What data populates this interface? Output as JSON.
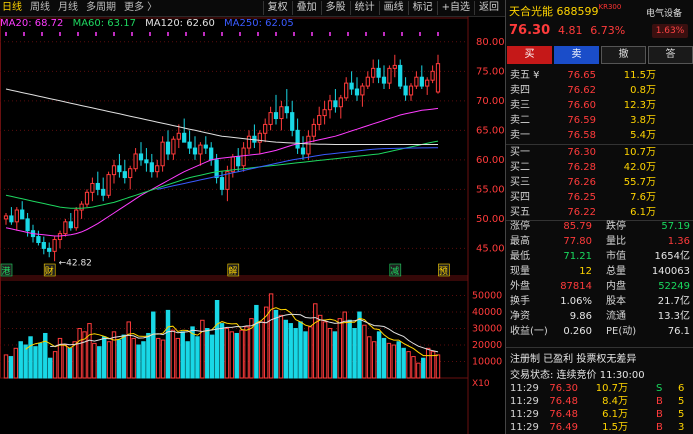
{
  "toolbar": {
    "tabs": [
      "日线",
      "周线",
      "月线",
      "多周期",
      "更多 〉"
    ],
    "active_tab": 0,
    "tools": [
      "复权",
      "叠加",
      "多股",
      "统计",
      "画线",
      "标记",
      "+自选",
      "返回"
    ]
  },
  "ma": [
    {
      "label": "MA20: 68.72",
      "color": "#ff3cff"
    },
    {
      "label": "MA60: 63.17",
      "color": "#1ed760"
    },
    {
      "label": "MA120: 62.60",
      "color": "#e0e0e0"
    },
    {
      "label": "MA250: 62.05",
      "color": "#3a5bff"
    }
  ],
  "colors": {
    "up": "#ff3b3b",
    "down": "#19d8e6",
    "grid": "#3a0a0a"
  },
  "chart_data": {
    "type": "candlestick",
    "price_axis": {
      "ticks": [
        45,
        50,
        55,
        60,
        65,
        70,
        75,
        80
      ],
      "ylim": [
        41,
        82
      ]
    },
    "price_tick_labels": [
      "45.00",
      "50.00",
      "55.00",
      "60.00",
      "65.00",
      "70.00",
      "75.00",
      "80.00"
    ],
    "volume_axis": {
      "ticks": [
        10000,
        20000,
        30000,
        40000,
        50000
      ],
      "ylim": [
        0,
        57000
      ]
    },
    "volume_tick_labels": [
      "10000",
      "20000",
      "30000",
      "40000",
      "50000"
    ],
    "volume_unit": "X10",
    "low_annotation": "←42.82",
    "low_price": 42.82,
    "event_markers": [
      {
        "index": 0,
        "label": "港",
        "color": "#1ed760"
      },
      {
        "index": 8,
        "label": "财",
        "color": "#ffd400"
      },
      {
        "index": 42,
        "label": "解",
        "color": "#ffd400"
      },
      {
        "index": 72,
        "label": "减",
        "color": "#1ed760"
      },
      {
        "index": 81,
        "label": "预",
        "color": "#ffd400"
      }
    ],
    "candles": [
      [
        50,
        51,
        49,
        50.5
      ],
      [
        50.5,
        52,
        49,
        49.5
      ],
      [
        49.5,
        52,
        48,
        51.5
      ],
      [
        51.5,
        53,
        50,
        50
      ],
      [
        50,
        51,
        47,
        48
      ],
      [
        48,
        49,
        46,
        47
      ],
      [
        47,
        48,
        45.5,
        46
      ],
      [
        46,
        47,
        44,
        45
      ],
      [
        45,
        46,
        43.5,
        44.5
      ],
      [
        44.5,
        47,
        42.82,
        46.5
      ],
      [
        46.5,
        48,
        45,
        47.5
      ],
      [
        47.5,
        50,
        47,
        49.5
      ],
      [
        49.5,
        51,
        48,
        48.5
      ],
      [
        48.5,
        52,
        48,
        51.5
      ],
      [
        51.5,
        53,
        50,
        52.5
      ],
      [
        52.5,
        55,
        52,
        54.5
      ],
      [
        54.5,
        57,
        53,
        56
      ],
      [
        56,
        58,
        54,
        55
      ],
      [
        55,
        57,
        53,
        54
      ],
      [
        54,
        58,
        53.5,
        57.5
      ],
      [
        57.5,
        60,
        56,
        59
      ],
      [
        59,
        61,
        57,
        58
      ],
      [
        58,
        60,
        56,
        57
      ],
      [
        57,
        59,
        55,
        58.5
      ],
      [
        58.5,
        62,
        58,
        61
      ],
      [
        61,
        63,
        59,
        60
      ],
      [
        60,
        62,
        58,
        59.5
      ],
      [
        59.5,
        61,
        57,
        58
      ],
      [
        58,
        60,
        57,
        59
      ],
      [
        59,
        64,
        58,
        63
      ],
      [
        63,
        65,
        60,
        61
      ],
      [
        61,
        64,
        60,
        63.5
      ],
      [
        63.5,
        66,
        62,
        64.5
      ],
      [
        64.5,
        67,
        63,
        63
      ],
      [
        63,
        65,
        61,
        62
      ],
      [
        62,
        64,
        60,
        61
      ],
      [
        61,
        63,
        59,
        62.5
      ],
      [
        62.5,
        64,
        61,
        62
      ],
      [
        62,
        63,
        59,
        60
      ],
      [
        60,
        61,
        56,
        57
      ],
      [
        57,
        58,
        54,
        55
      ],
      [
        55,
        59,
        53,
        58
      ],
      [
        58,
        61,
        57,
        60.5
      ],
      [
        60.5,
        62,
        58,
        59
      ],
      [
        59,
        63,
        58,
        62
      ],
      [
        62,
        65,
        61,
        64
      ],
      [
        64,
        66,
        62,
        63
      ],
      [
        63,
        65,
        61,
        64.5
      ],
      [
        64.5,
        67,
        63,
        66
      ],
      [
        66,
        69,
        65,
        68
      ],
      [
        68,
        71,
        66,
        67
      ],
      [
        67,
        70,
        65,
        69
      ],
      [
        69,
        72,
        67,
        68
      ],
      [
        68,
        70,
        64,
        65
      ],
      [
        65,
        67,
        61,
        62
      ],
      [
        62,
        64,
        60,
        61
      ],
      [
        61,
        65,
        60,
        64
      ],
      [
        64,
        67,
        63,
        66
      ],
      [
        66,
        69,
        65,
        67.5
      ],
      [
        67.5,
        70,
        66,
        68.5
      ],
      [
        68.5,
        71,
        67,
        70
      ],
      [
        70,
        72,
        68,
        69
      ],
      [
        69,
        71,
        67,
        70.5
      ],
      [
        70.5,
        74,
        70,
        73
      ],
      [
        73,
        75,
        71,
        72
      ],
      [
        72,
        74,
        70,
        71
      ],
      [
        71,
        73,
        69,
        72.5
      ],
      [
        72.5,
        75,
        72,
        74
      ],
      [
        74,
        77,
        73,
        75.5
      ],
      [
        75.5,
        77,
        73,
        74
      ],
      [
        74,
        76,
        72,
        73
      ],
      [
        73,
        76,
        72,
        75.5
      ],
      [
        75.5,
        77.8,
        74,
        76
      ],
      [
        76,
        77,
        72,
        72.5
      ],
      [
        72.5,
        74,
        70,
        71
      ],
      [
        71,
        73,
        70,
        72.5
      ],
      [
        72.5,
        75,
        72,
        74
      ],
      [
        74,
        76,
        72,
        72.5
      ],
      [
        72.5,
        74,
        71,
        73.5
      ],
      [
        73.5,
        76,
        73,
        75
      ],
      [
        71.5,
        77.8,
        71.21,
        76.3
      ]
    ],
    "ma_series": [
      {
        "name": "MA20",
        "color": "#ff3cff",
        "values": [
          48.5,
          48.3,
          48.1,
          47.9,
          47.7,
          47.5,
          47.4,
          47.3,
          47.2,
          47.1,
          47.1,
          47.2,
          47.3,
          47.5,
          47.8,
          48.2,
          48.7,
          49.2,
          49.8,
          50.4,
          51,
          51.6,
          52.2,
          52.8,
          53.4,
          54,
          54.5,
          55,
          55.5,
          56,
          56.5,
          57,
          57.5,
          58,
          58.4,
          58.8,
          59.2,
          59.6,
          60,
          60.2,
          60.3,
          60.4,
          60.5,
          60.6,
          60.7,
          60.8,
          60.9,
          61,
          61.2,
          61.4,
          61.6,
          61.9,
          62.2,
          62.5,
          62.7,
          62.8,
          63,
          63.2,
          63.4,
          63.6,
          63.8,
          64,
          64.3,
          64.6,
          64.9,
          65.2,
          65.5,
          65.8,
          66.1,
          66.4,
          66.7,
          67,
          67.3,
          67.6,
          67.8,
          68,
          68.2,
          68.4,
          68.5,
          68.6,
          68.72
        ]
      },
      {
        "name": "MA60",
        "color": "#1ed760",
        "values": [
          54,
          53.8,
          53.6,
          53.4,
          53.2,
          53,
          52.8,
          52.6,
          52.4,
          52.2,
          52,
          51.9,
          51.8,
          51.8,
          51.8,
          51.9,
          52,
          52.2,
          52.4,
          52.6,
          52.8,
          53.1,
          53.4,
          53.7,
          54,
          54.3,
          54.6,
          54.9,
          55.2,
          55.5,
          55.8,
          56.1,
          56.4,
          56.7,
          57,
          57.2,
          57.4,
          57.6,
          57.8,
          58,
          58.1,
          58.2,
          58.3,
          58.4,
          58.5,
          58.6,
          58.7,
          58.8,
          58.9,
          59,
          59.1,
          59.2,
          59.3,
          59.4,
          59.5,
          59.6,
          59.7,
          59.8,
          59.9,
          60,
          60.1,
          60.2,
          60.3,
          60.4,
          60.5,
          60.6,
          60.7,
          60.8,
          60.9,
          61,
          61.2,
          61.4,
          61.6,
          61.8,
          62,
          62.2,
          62.4,
          62.6,
          62.8,
          63,
          63.17
        ]
      },
      {
        "name": "MA120",
        "color": "#e0e0e0",
        "values": [
          72,
          71.8,
          71.6,
          71.4,
          71.2,
          71,
          70.8,
          70.6,
          70.4,
          70.2,
          70,
          69.8,
          69.6,
          69.4,
          69.2,
          69,
          68.8,
          68.6,
          68.4,
          68.2,
          68,
          67.8,
          67.6,
          67.4,
          67.2,
          67,
          66.8,
          66.6,
          66.4,
          66.2,
          66,
          65.8,
          65.6,
          65.4,
          65.2,
          65,
          64.8,
          64.6,
          64.4,
          64.2,
          64,
          63.9,
          63.8,
          63.7,
          63.6,
          63.5,
          63.4,
          63.3,
          63.2,
          63.1,
          63,
          62.95,
          62.9,
          62.85,
          62.8,
          62.75,
          62.7,
          62.68,
          62.66,
          62.64,
          62.62,
          62.6,
          62.6,
          62.6,
          62.6,
          62.6,
          62.6,
          62.6,
          62.6,
          62.6,
          62.6,
          62.6,
          62.6,
          62.6,
          62.6,
          62.6,
          62.6,
          62.6,
          62.6,
          62.6,
          62.6
        ]
      },
      {
        "name": "MA250",
        "color": "#3a5bff",
        "values": [
          null,
          null,
          null,
          null,
          null,
          null,
          null,
          null,
          null,
          null,
          null,
          null,
          null,
          null,
          null,
          null,
          null,
          null,
          null,
          null,
          null,
          null,
          null,
          null,
          null,
          null,
          null,
          null,
          55,
          55.2,
          55.4,
          55.6,
          55.8,
          56,
          56.2,
          56.4,
          56.6,
          56.8,
          57,
          57.2,
          57.4,
          57.6,
          57.8,
          58,
          58.2,
          58.4,
          58.6,
          58.8,
          59,
          59.2,
          59.4,
          59.6,
          59.8,
          60,
          60.15,
          60.3,
          60.45,
          60.6,
          60.75,
          60.9,
          61,
          61.1,
          61.2,
          61.3,
          61.4,
          61.5,
          61.6,
          61.7,
          61.8,
          61.85,
          61.9,
          61.92,
          61.94,
          61.96,
          61.98,
          62,
          62.01,
          62.02,
          62.03,
          62.04,
          62.05
        ]
      }
    ],
    "volumes": [
      14000,
      13000,
      18000,
      22000,
      20000,
      25000,
      19000,
      21000,
      27000,
      12000,
      16000,
      24000,
      20000,
      18000,
      22000,
      30000,
      28000,
      33000,
      21000,
      19000,
      25000,
      22000,
      28000,
      23000,
      26000,
      34000,
      24000,
      20000,
      22000,
      27000,
      40000,
      24000,
      23000,
      41000,
      29000,
      24000,
      28000,
      22000,
      31000,
      25000,
      35000,
      30000,
      26000,
      47000,
      33000,
      30000,
      28000,
      27000,
      29000,
      31000,
      36000,
      44000,
      34000,
      43000,
      51000,
      41000,
      38000,
      35000,
      33000,
      30000,
      34000,
      28000,
      31000,
      45000,
      38000,
      34000,
      30000,
      28000,
      36000,
      40000,
      35000,
      30000,
      40000,
      32000,
      25000,
      22000,
      28000,
      24000,
      21000,
      20000,
      22000,
      18000,
      16000,
      13000,
      9000,
      12000,
      18000,
      16000,
      14000
    ],
    "volume_ma": [
      {
        "name": "MA5",
        "color": "#ffd400"
      },
      {
        "name": "MA10",
        "color": "#e0e0e0"
      }
    ]
  },
  "quote": {
    "name": "天合光能",
    "code": "688599",
    "kr": "KR300",
    "sector": "电气设备",
    "sector_change": "1.63%",
    "price": "76.30",
    "change": "4.81",
    "change_pct": "6.73%"
  },
  "trade_buttons": [
    "买",
    "卖",
    "撤",
    "答"
  ],
  "asks": [
    {
      "label": "卖五 ¥",
      "price": "76.65",
      "vol": "11.5万"
    },
    {
      "label": "卖四",
      "price": "76.62",
      "vol": "0.8万"
    },
    {
      "label": "卖三",
      "price": "76.60",
      "vol": "12.3万"
    },
    {
      "label": "卖二",
      "price": "76.59",
      "vol": "3.8万"
    },
    {
      "label": "卖一",
      "price": "76.58",
      "vol": "5.4万"
    }
  ],
  "bids": [
    {
      "label": "买一",
      "price": "76.30",
      "vol": "10.7万"
    },
    {
      "label": "买二",
      "price": "76.28",
      "vol": "42.0万"
    },
    {
      "label": "买三",
      "price": "76.26",
      "vol": "55.7万"
    },
    {
      "label": "买四",
      "price": "76.25",
      "vol": "7.6万"
    },
    {
      "label": "买五",
      "price": "76.22",
      "vol": "6.1万"
    }
  ],
  "stats": [
    {
      "a": "涨停",
      "av": "85.79",
      "ac": "red",
      "b": "跌停",
      "bv": "57.19",
      "bc": "green"
    },
    {
      "a": "最高",
      "av": "77.80",
      "ac": "red",
      "b": "量比",
      "bv": "1.36",
      "bc": "red"
    },
    {
      "a": "最低",
      "av": "71.21",
      "ac": "green",
      "b": "市值",
      "bv": "1654亿",
      "bc": "white"
    },
    {
      "a": "现量",
      "av": "12",
      "ac": "yellow",
      "b": "总量",
      "bv": "140063",
      "bc": "white"
    },
    {
      "a": "外盘",
      "av": "87814",
      "ac": "red",
      "b": "内盘",
      "bv": "52249",
      "bc": "green"
    },
    {
      "a": "换手",
      "av": "1.06%",
      "ac": "white",
      "b": "股本",
      "bv": "21.7亿",
      "bc": "white"
    },
    {
      "a": "净资",
      "av": "9.86",
      "ac": "white",
      "b": "流通",
      "bv": "13.3亿",
      "bc": "white"
    },
    {
      "a": "收益(一)",
      "av": "0.260",
      "ac": "white",
      "b": "PE(动)",
      "bv": "76.1",
      "bc": "white"
    }
  ],
  "info_line1": "注册制  已盈利  投票权无差异",
  "info_line2": "交易状态: 连续竞价 11:30:00",
  "ticks": [
    {
      "t": "11:29",
      "p": "76.30",
      "v": "10.7万",
      "d": "S",
      "dc": "green",
      "n": "6"
    },
    {
      "t": "11:29",
      "p": "76.48",
      "v": "8.4万",
      "d": "B",
      "dc": "red",
      "n": "5"
    },
    {
      "t": "11:29",
      "p": "76.48",
      "v": "6.1万",
      "d": "B",
      "dc": "red",
      "n": "5"
    },
    {
      "t": "11:29",
      "p": "76.49",
      "v": "1.5万",
      "d": "B",
      "dc": "red",
      "n": "3"
    }
  ]
}
